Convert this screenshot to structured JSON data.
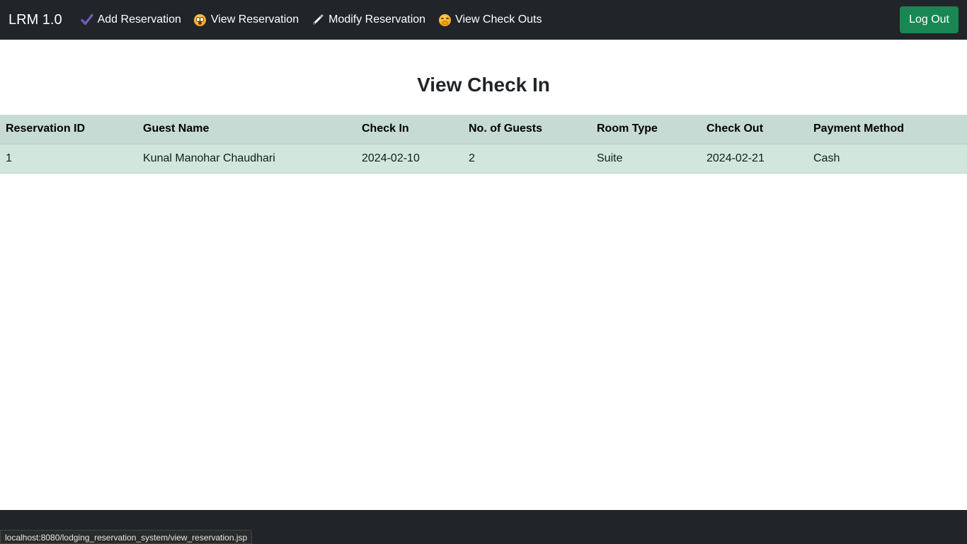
{
  "navbar": {
    "brand": "LRM 1.0",
    "links": [
      {
        "label": "Add Reservation",
        "icon": "check-icon"
      },
      {
        "label": "View Reservation",
        "icon": "shocked-face-icon"
      },
      {
        "label": "Modify Reservation",
        "icon": "pen-icon"
      },
      {
        "label": "View Check Outs",
        "icon": "giggle-face-icon"
      }
    ],
    "logout_label": "Log Out"
  },
  "main": {
    "title": "View Check In",
    "table": {
      "headers": [
        "Reservation ID",
        "Guest Name",
        "Check In",
        "No. of Guests",
        "Room Type",
        "Check Out",
        "Payment Method"
      ],
      "rows": [
        [
          "1",
          "Kunal Manohar Chaudhari",
          "2024-02-10",
          "2",
          "Suite",
          "2024-02-21",
          "Cash"
        ]
      ]
    }
  },
  "status_bar": {
    "url": "localhost:8080/lodging_reservation_system/view_reservation.jsp"
  },
  "colors": {
    "navbar_bg": "#212529",
    "logout_bg": "#198754",
    "table_header_bg": "#c6dbd3",
    "table_row_bg": "#d1e7dd",
    "check_icon": "#6f5fb8"
  }
}
